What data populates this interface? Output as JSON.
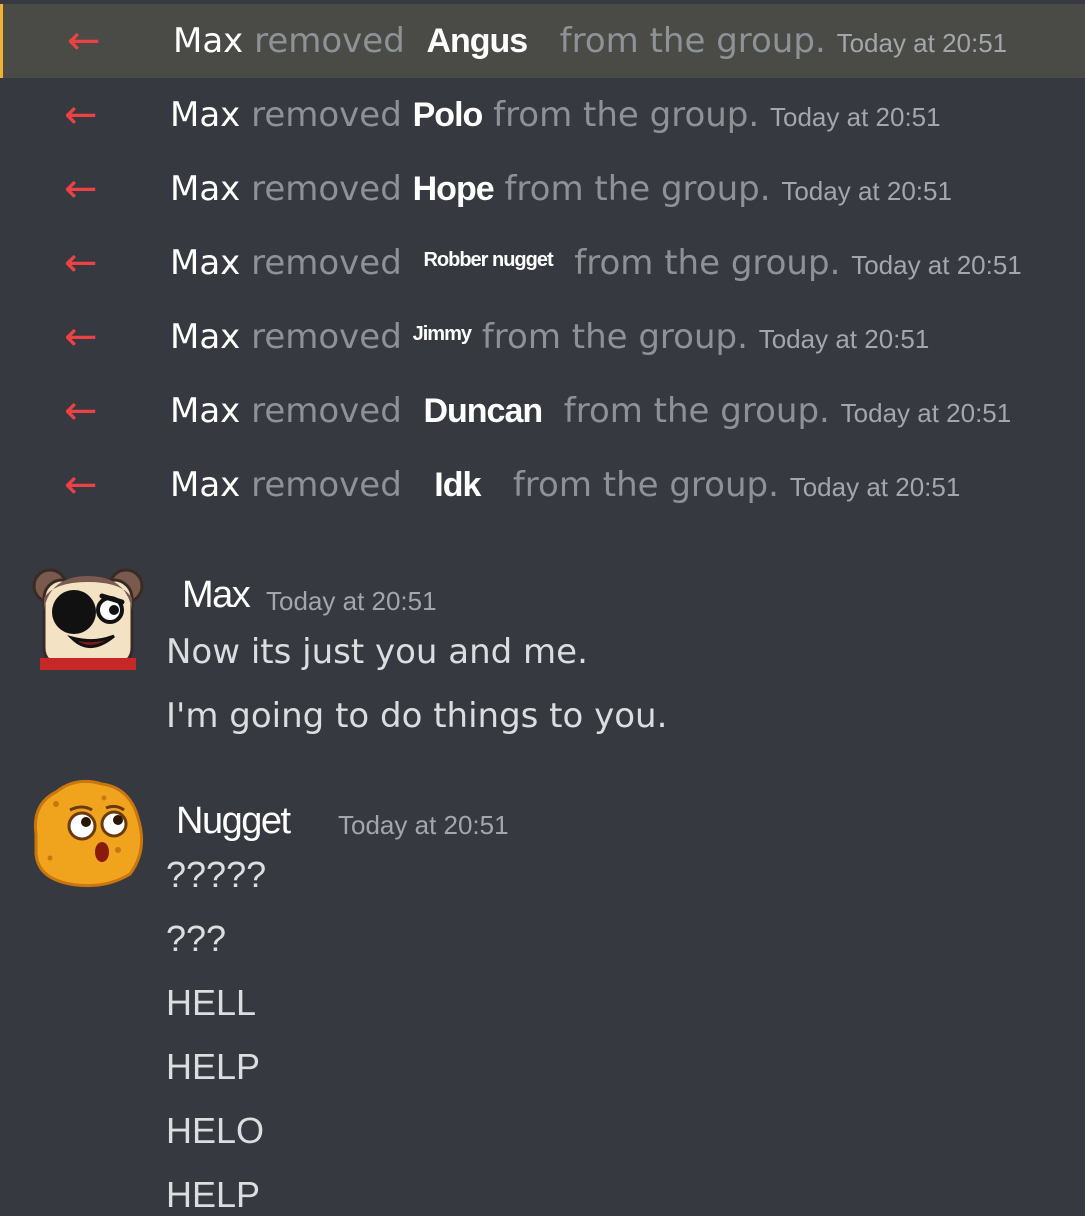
{
  "system_events": [
    {
      "actor": "Max",
      "verb": "removed",
      "target": "Angus",
      "tail": "from the group.",
      "time": "Today at 20:51"
    },
    {
      "actor": "Max",
      "verb": "removed",
      "target": "Polo",
      "tail": "from the group.",
      "time": "Today at 20:51"
    },
    {
      "actor": "Max",
      "verb": "removed",
      "target": "Hope",
      "tail": "from the group.",
      "time": "Today at 20:51"
    },
    {
      "actor": "Max",
      "verb": "removed",
      "target": "Robber nugget",
      "tail": "from the group.",
      "time": "Today at 20:51"
    },
    {
      "actor": "Max",
      "verb": "removed",
      "target": "Jimmy",
      "tail": "from the group.",
      "time": "Today at 20:51"
    },
    {
      "actor": "Max",
      "verb": "removed",
      "target": "Duncan",
      "tail": "from the group.",
      "time": "Today at 20:51"
    },
    {
      "actor": "Max",
      "verb": "removed",
      "target": "Idk",
      "tail": "from the group.",
      "time": "Today at 20:51"
    }
  ],
  "icons": {
    "event": "leave-arrow-icon",
    "event_color": "#ed4245",
    "highlight_accent": "#f0b232"
  },
  "messages": [
    {
      "author": "Max",
      "time": "Today at 20:51",
      "avatar": "bear-avatar",
      "lines": [
        "Now its just you and me.",
        "I'm going to do things to you."
      ]
    },
    {
      "author": "Nugget",
      "time": "Today at 20:51",
      "avatar": "chicken-nugget-avatar",
      "lines": [
        "?????",
        "???",
        "HELL",
        "HELP",
        "HELO",
        "HELP"
      ]
    }
  ]
}
